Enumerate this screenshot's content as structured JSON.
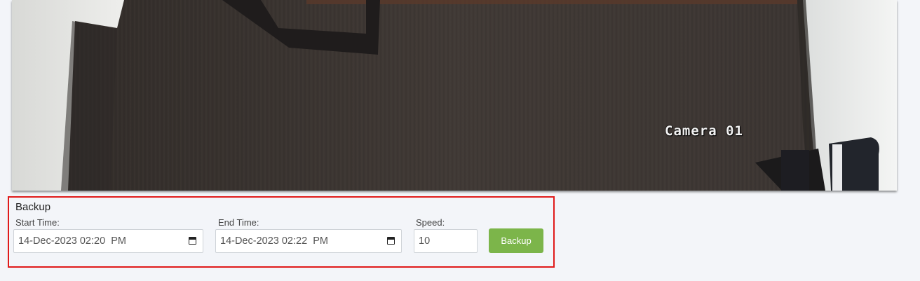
{
  "camera": {
    "overlay_label": "Camera 01"
  },
  "backup": {
    "title": "Backup",
    "start_time": {
      "label": "Start Time:",
      "value": "14-Dec-2023 02:20  PM"
    },
    "end_time": {
      "label": "End Time:",
      "value": "14-Dec-2023 02:22  PM"
    },
    "speed": {
      "label": "Speed:",
      "value": "10"
    },
    "button_label": "Backup"
  },
  "colors": {
    "panel_border": "#e01a1a",
    "button_bg": "#7cb54a",
    "page_bg": "#f3f5f9"
  },
  "icons": {
    "start_time_picker": "calendar-icon",
    "end_time_picker": "calendar-icon"
  }
}
